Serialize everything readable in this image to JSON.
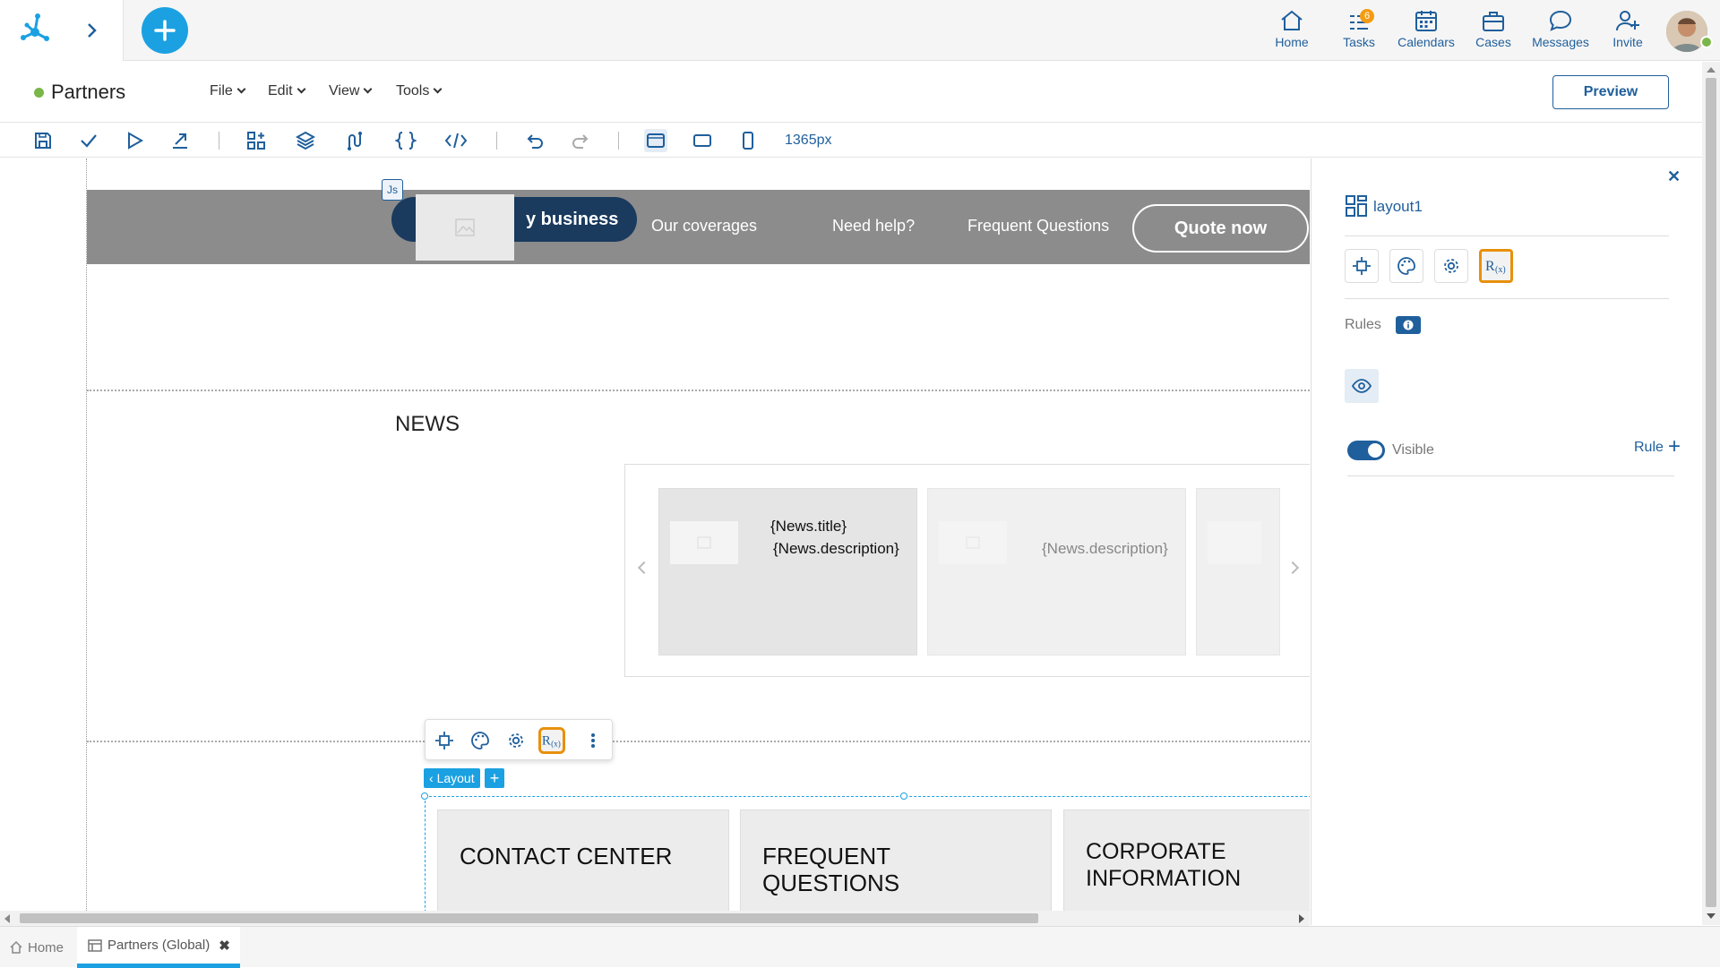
{
  "topnav": {
    "items": [
      {
        "label": "Home",
        "icon": "home-icon"
      },
      {
        "label": "Tasks",
        "icon": "tasks-icon",
        "badge": "6"
      },
      {
        "label": "Calendars",
        "icon": "calendar-icon"
      },
      {
        "label": "Cases",
        "icon": "briefcase-icon"
      },
      {
        "label": "Messages",
        "icon": "chat-icon"
      },
      {
        "label": "Invite",
        "icon": "add-user-icon"
      }
    ]
  },
  "header": {
    "title": "Partners",
    "menus": [
      "File",
      "Edit",
      "View",
      "Tools"
    ],
    "preview_label": "Preview"
  },
  "toolbar": {
    "width_label": "1365px"
  },
  "canvas": {
    "js_tag": "Js",
    "hero": {
      "pill_text": "y business",
      "links": [
        "Our coverages",
        "Need help?",
        "Frequent Questions"
      ],
      "quote_label": "Quote now"
    },
    "news_title": "NEWS",
    "carousel": {
      "card1_title": "{News.title}",
      "card1_desc": "{News.description}",
      "card2_desc": "{News.description}"
    },
    "layout_tag": "Layout",
    "info_cards": [
      "CONTACT CENTER",
      "FREQUENT QUESTIONS",
      "CORPORATE INFORMATION"
    ]
  },
  "panel": {
    "title": "layout1",
    "rules_label": "Rules",
    "visible_label": "Visible",
    "visible_on": true,
    "rule_link": "Rule"
  },
  "bottom_tabs": [
    {
      "label": "Home"
    },
    {
      "label": "Partners (Global)"
    }
  ],
  "colors": {
    "accent": "#1ba1e2",
    "brand_blue": "#1f5f9c",
    "rx_highlight": "#e8900c",
    "status_green": "#7ab648",
    "hero_bg": "#8c8c8c",
    "pill_bg": "#1a3a5e"
  }
}
